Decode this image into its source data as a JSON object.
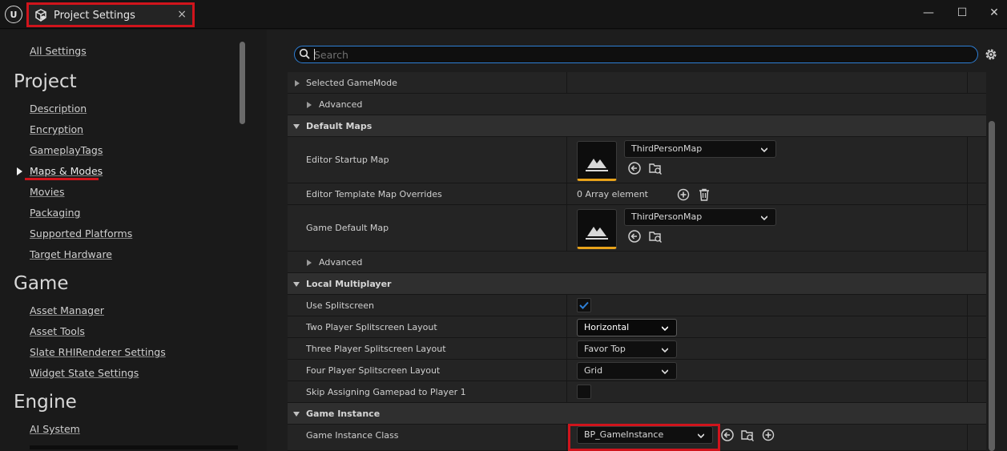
{
  "window": {
    "tab_title": "Project Settings",
    "close_glyph": "×",
    "minimize_glyph": "—",
    "maximize_glyph": "☐",
    "window_close_glyph": "✕",
    "logo_text": "U"
  },
  "sidebar": {
    "all_settings": "All Settings",
    "sections": [
      {
        "title": "Project",
        "items": [
          "Description",
          "Encryption",
          "GameplayTags",
          "Maps & Modes",
          "Movies",
          "Packaging",
          "Supported Platforms",
          "Target Hardware"
        ]
      },
      {
        "title": "Game",
        "items": [
          "Asset Manager",
          "Asset Tools",
          "Slate RHIRenderer Settings",
          "Widget State Settings"
        ]
      },
      {
        "title": "Engine",
        "items": [
          "AI System"
        ]
      }
    ],
    "selected_item": "Maps & Modes"
  },
  "search": {
    "placeholder": "Search",
    "value": ""
  },
  "properties": {
    "selected_gamemode": "Selected GameMode",
    "advanced_1": "Advanced",
    "default_maps_header": "Default Maps",
    "editor_startup_map": {
      "label": "Editor Startup Map",
      "value": "ThirdPersonMap"
    },
    "editor_template_overrides": {
      "label": "Editor Template Map Overrides",
      "value": "0 Array element"
    },
    "game_default_map": {
      "label": "Game Default Map",
      "value": "ThirdPersonMap"
    },
    "advanced_2": "Advanced",
    "local_multiplayer_header": "Local Multiplayer",
    "use_splitscreen": {
      "label": "Use Splitscreen",
      "checked": true
    },
    "two_player_layout": {
      "label": "Two Player Splitscreen Layout",
      "value": "Horizontal"
    },
    "three_player_layout": {
      "label": "Three Player Splitscreen Layout",
      "value": "Favor Top"
    },
    "four_player_layout": {
      "label": "Four Player Splitscreen Layout",
      "value": "Grid"
    },
    "skip_gamepad": {
      "label": "Skip Assigning Gamepad to Player 1",
      "checked": false
    },
    "game_instance_header": "Game Instance",
    "game_instance_class": {
      "label": "Game Instance Class",
      "value": "BP_GameInstance"
    }
  },
  "colors": {
    "highlight_red": "#d0141c",
    "accent_blue": "#2e7fd6",
    "asset_orange": "#e8a21a"
  }
}
